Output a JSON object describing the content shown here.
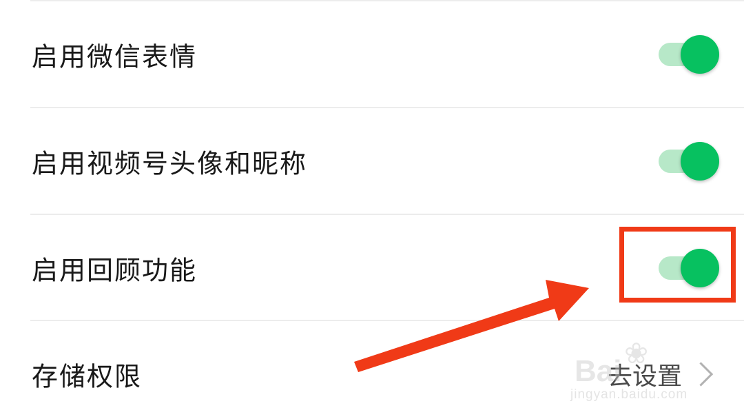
{
  "settings": {
    "items": [
      {
        "label": "启用微信表情",
        "type": "toggle",
        "enabled": true
      },
      {
        "label": "启用视频号头像和昵称",
        "type": "toggle",
        "enabled": true
      },
      {
        "label": "启用回顾功能",
        "type": "toggle",
        "enabled": true
      },
      {
        "label": "存储权限",
        "type": "link",
        "value": "去设置"
      }
    ]
  },
  "colors": {
    "toggle_on_thumb": "#07c160",
    "toggle_on_track": "#b7e8c8",
    "annotation_red": "#f03a17",
    "label_text": "#191919",
    "divider": "#ececec"
  },
  "annotation": {
    "type": "highlight-with-arrow",
    "target": "启用回顾功能 toggle"
  },
  "watermark": {
    "brand": "Bai",
    "url": "jingyan.baidu.com"
  },
  "icons": {
    "chevron": "chevron-right-icon",
    "paw": "baidu-paw-icon"
  }
}
